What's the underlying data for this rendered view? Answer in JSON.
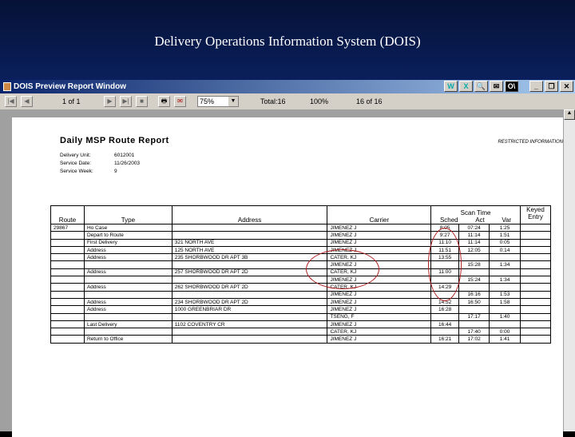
{
  "slide": {
    "title": "Delivery Operations Information System (DOIS)"
  },
  "window": {
    "title": "DOIS Preview Report Window",
    "controls": [
      "_",
      "❐",
      "✕"
    ],
    "app_icons": [
      "W",
      "X",
      "🔍",
      "✉",
      "O\\"
    ]
  },
  "toolbar": {
    "page": "1 of 1",
    "zoom": "75%",
    "total": "Total:16",
    "percent": "100%",
    "count": "16 of 16"
  },
  "report": {
    "title": "Daily MSP Route Report",
    "restricted": "RESTRICTED INFORMATION",
    "meta": [
      {
        "label": "Delivery Unit:",
        "value": "6012001"
      },
      {
        "label": "Service Date:",
        "value": "11/26/2003"
      },
      {
        "label": "Service Week:",
        "value": "9"
      }
    ],
    "headers": {
      "route": "Route",
      "type": "Type",
      "address": "Address",
      "carrier": "Carrier",
      "scan_time": "Scan Time",
      "sched": "Sched",
      "act": "Act",
      "var": "Var",
      "keyed": "Keyed Entry"
    },
    "rows": [
      [
        "29867",
        "Ho Case",
        "",
        "JIMENEZ J",
        "8:05",
        "07:24",
        "1:25"
      ],
      [
        "",
        "Depart to Route",
        "",
        "JIMENEZ J",
        "9:27",
        "11:14",
        "1:51"
      ],
      [
        "",
        "First Delivery",
        "321 NORTH AVE",
        "JIMENEZ J",
        "11:10",
        "11:14",
        "0:05"
      ],
      [
        "",
        "Address",
        "125 NORTH AVE",
        "JIMENEZ J",
        "11:51",
        "12:05",
        "0:14"
      ],
      [
        "",
        "Address",
        "235 SHORBWOOD DR APT 3B",
        "CATER, KJ",
        "13:55",
        "",
        ""
      ],
      [
        "",
        "",
        "",
        "JIMENEZ J",
        "",
        "15:28",
        "1:34"
      ],
      [
        "",
        "Address",
        "257 SHORBWOOD DR APT 2D",
        "CATER, KJ",
        "11:00",
        "",
        ""
      ],
      [
        "",
        "",
        "",
        "JIMENEZ J",
        "",
        "15:24",
        "1:34"
      ],
      [
        "",
        "Address",
        "262 SHORBWOOD DR APT 2D",
        "CATER, KJ",
        "14:29",
        "",
        ""
      ],
      [
        "",
        "",
        "",
        "JIMENEZ J",
        "",
        "16:16",
        "1:53"
      ],
      [
        "",
        "Address",
        "234 SHORBWOOD DR APT 2D",
        "JIMENEZ J",
        "14:52",
        "16:50",
        "1:58"
      ],
      [
        "",
        "Address",
        "1000 GREENBRIAR DR",
        "JIMENEZ J",
        "16:28",
        "",
        ""
      ],
      [
        "",
        "",
        "",
        "TSENG, F",
        "",
        "17:17",
        "1:40"
      ],
      [
        "",
        "Last Delivery",
        "1102 COVENTRY CR",
        "JIMENEZ J",
        "16:44",
        "",
        ""
      ],
      [
        "",
        "",
        "",
        "CATER, KJ",
        "",
        "17:40",
        "0:00"
      ],
      [
        "",
        "Return to Office",
        "",
        "JIMENEZ J",
        "16:21",
        "17:02",
        "1:41"
      ]
    ]
  }
}
